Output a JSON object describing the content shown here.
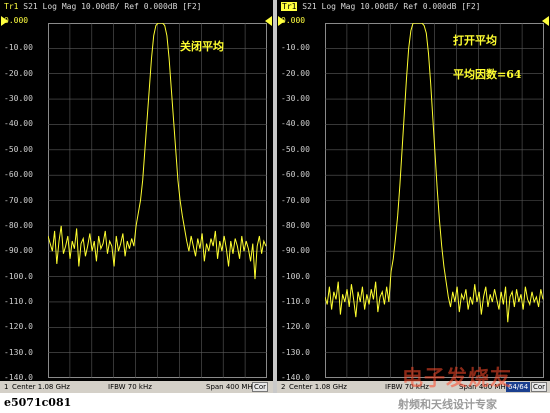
{
  "left": {
    "trace_id": "Tr1",
    "header": "S21 Log Mag 10.00dB/ Ref 0.000dB [F2]",
    "annotations": [
      "关闭平均"
    ],
    "status": {
      "channel": "1",
      "center": "Center 1.08 GHz",
      "ifbw": "IFBW 70 kHz",
      "span": "Span 400 MHz",
      "cor": "Cor",
      "avg": ""
    }
  },
  "right": {
    "trace_id": "Tr1",
    "header": "S21 Log Mag 10.00dB/ Ref 0.000dB [F2]",
    "annotations": [
      "打开平均",
      "平均因数=64"
    ],
    "status": {
      "channel": "2",
      "center": "Center 1.08 GHz",
      "ifbw": "IFBW 70 kHz",
      "span": "Span 400 MHz",
      "cor": "Cor",
      "avg": "64/64"
    }
  },
  "y_ticks": [
    "0.000",
    "-10.00",
    "-20.00",
    "-30.00",
    "-40.00",
    "-50.00",
    "-60.00",
    "-70.00",
    "-80.00",
    "-90.00",
    "-100.0",
    "-110.0",
    "-120.0",
    "-130.0",
    "-140.0"
  ],
  "footer": "e5071c081",
  "watermark": {
    "logo": "电子发烧友",
    "subtitle": "射频和天线设计专家"
  },
  "colors": {
    "trace": "#ffff30",
    "grid": "#5a5a5a",
    "background": "#000000",
    "statusbar": "#d4d0c8"
  },
  "chart_data": [
    {
      "type": "line",
      "title": "S21 Log Mag 10.00dB/ Ref 0.000dB [F2]",
      "xlabel": "",
      "ylabel": "",
      "ylim": [
        -140,
        0
      ],
      "ref_level": 0,
      "center": "1.08 GHz",
      "span": "400 MHz",
      "averaging": "off",
      "noise_floor_range": [
        -105,
        -80
      ],
      "peak": 0,
      "series": [
        {
          "values": [
            -84,
            -87,
            -90,
            -82,
            -95,
            -86,
            -80,
            -91,
            -88,
            -84,
            -93,
            -86,
            -89,
            -81,
            -96,
            -87,
            -85,
            -92,
            -88,
            -83,
            -90,
            -86,
            -94,
            -84,
            -89,
            -87,
            -82,
            -91,
            -86,
            -88,
            -96,
            -84,
            -90,
            -87,
            -83,
            -92,
            -86,
            -89,
            -85,
            -88,
            -80,
            -75,
            -70,
            -62,
            -50,
            -38,
            -26,
            -14,
            -5,
            -1,
            0,
            0,
            0,
            -1,
            -5,
            -14,
            -26,
            -38,
            -50,
            -62,
            -70,
            -76,
            -81,
            -86,
            -90,
            -84,
            -88,
            -92,
            -85,
            -89,
            -83,
            -94,
            -87,
            -90,
            -85,
            -88,
            -82,
            -93,
            -86,
            -90,
            -84,
            -89,
            -96,
            -86,
            -91,
            -85,
            -88,
            -93,
            -84,
            -90,
            -86,
            -89,
            -94,
            -87,
            -101,
            -88,
            -84,
            -91,
            -86,
            -88
          ]
        }
      ]
    },
    {
      "type": "line",
      "title": "S21 Log Mag 10.00dB/ Ref 0.000dB [F2]",
      "xlabel": "",
      "ylabel": "",
      "ylim": [
        -140,
        0
      ],
      "ref_level": 0,
      "center": "1.08 GHz",
      "span": "400 MHz",
      "averaging": "on",
      "averaging_factor": 64,
      "noise_floor_range": [
        -120,
        -100
      ],
      "peak": 0,
      "series": [
        {
          "values": [
            -108,
            -111,
            -104,
            -113,
            -106,
            -109,
            -102,
            -115,
            -107,
            -110,
            -105,
            -112,
            -103,
            -109,
            -116,
            -106,
            -110,
            -104,
            -113,
            -107,
            -111,
            -105,
            -109,
            -102,
            -114,
            -108,
            -106,
            -111,
            -104,
            -110,
            -98,
            -93,
            -85,
            -76,
            -64,
            -50,
            -36,
            -22,
            -10,
            -3,
            0,
            0,
            0,
            0,
            0,
            -1,
            -4,
            -12,
            -24,
            -38,
            -52,
            -66,
            -78,
            -88,
            -96,
            -102,
            -108,
            -112,
            -106,
            -110,
            -104,
            -114,
            -107,
            -109,
            -105,
            -113,
            -108,
            -111,
            -103,
            -110,
            -106,
            -115,
            -108,
            -104,
            -112,
            -107,
            -110,
            -105,
            -109,
            -113,
            -106,
            -111,
            -104,
            -118,
            -108,
            -106,
            -112,
            -105,
            -110,
            -107,
            -113,
            -104,
            -109,
            -111,
            -106,
            -110,
            -108,
            -112,
            -105,
            -109
          ]
        }
      ]
    }
  ]
}
